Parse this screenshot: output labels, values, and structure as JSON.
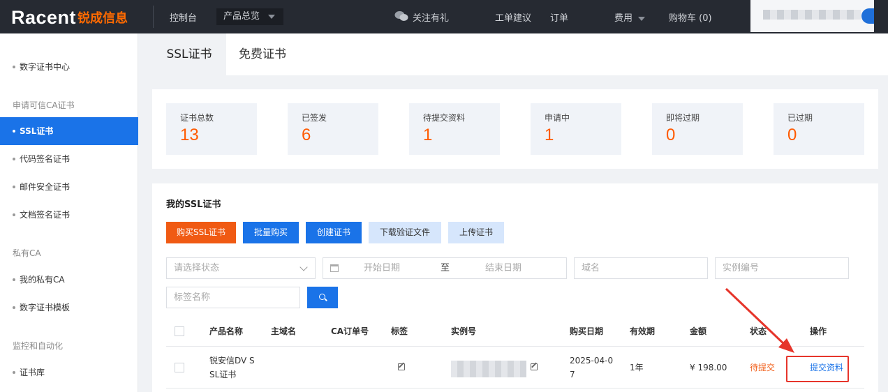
{
  "header": {
    "logo_en": "Racent",
    "logo_cn": "锐成信息",
    "console": "控制台",
    "product_overview": "产品总览",
    "follow": "关注有礼",
    "ticket": "工单建议",
    "orders": "订单",
    "fees": "费用",
    "cart": "购物车 (0)"
  },
  "sidebar": {
    "items": [
      {
        "label": "数字证书中心"
      },
      {
        "group": "申请可信CA证书"
      },
      {
        "label": "SSL证书"
      },
      {
        "label": "代码签名证书"
      },
      {
        "label": "邮件安全证书"
      },
      {
        "label": "文档签名证书"
      },
      {
        "group": "私有CA"
      },
      {
        "label": "我的私有CA"
      },
      {
        "label": "数字证书模板"
      },
      {
        "group": "监控和自动化"
      },
      {
        "label": "证书库"
      }
    ]
  },
  "tabs": [
    {
      "label": "SSL证书",
      "active": true
    },
    {
      "label": "免费证书",
      "active": false
    }
  ],
  "stats": [
    {
      "label": "证书总数",
      "value": "13"
    },
    {
      "label": "已签发",
      "value": "6"
    },
    {
      "label": "待提交资料",
      "value": "1"
    },
    {
      "label": "申请中",
      "value": "1"
    },
    {
      "label": "即将过期",
      "value": "0"
    },
    {
      "label": "已过期",
      "value": "0"
    }
  ],
  "list": {
    "title": "我的SSL证书",
    "buttons": {
      "buy": "购买SSL证书",
      "bulk": "批量购买",
      "create": "创建证书",
      "download": "下载验证文件",
      "upload": "上传证书"
    },
    "filters": {
      "status_placeholder": "请选择状态",
      "start_date": "开始日期",
      "to": "至",
      "end_date": "结束日期",
      "domain_placeholder": "域名",
      "instance_placeholder": "实例编号",
      "tag_placeholder": "标签名称"
    },
    "columns": {
      "product": "产品名称",
      "domain": "主域名",
      "ca_order": "CA订单号",
      "tag": "标签",
      "instance": "实例号",
      "date": "购买日期",
      "validity": "有效期",
      "amount": "金额",
      "status": "状态",
      "action": "操作"
    },
    "rows": [
      {
        "product_l1": "锐安信DV S",
        "product_l2": "SL证书",
        "date_l1": "2025-04-0",
        "date_l2": "7",
        "validity": "1年",
        "amount": "¥ 198.00",
        "status": "待提交",
        "action": "提交资料"
      }
    ]
  },
  "colors": {
    "accent": "#1a73e8",
    "orange": "#f05a13",
    "topbar": "#262a32",
    "annotation": "#e6352b"
  }
}
